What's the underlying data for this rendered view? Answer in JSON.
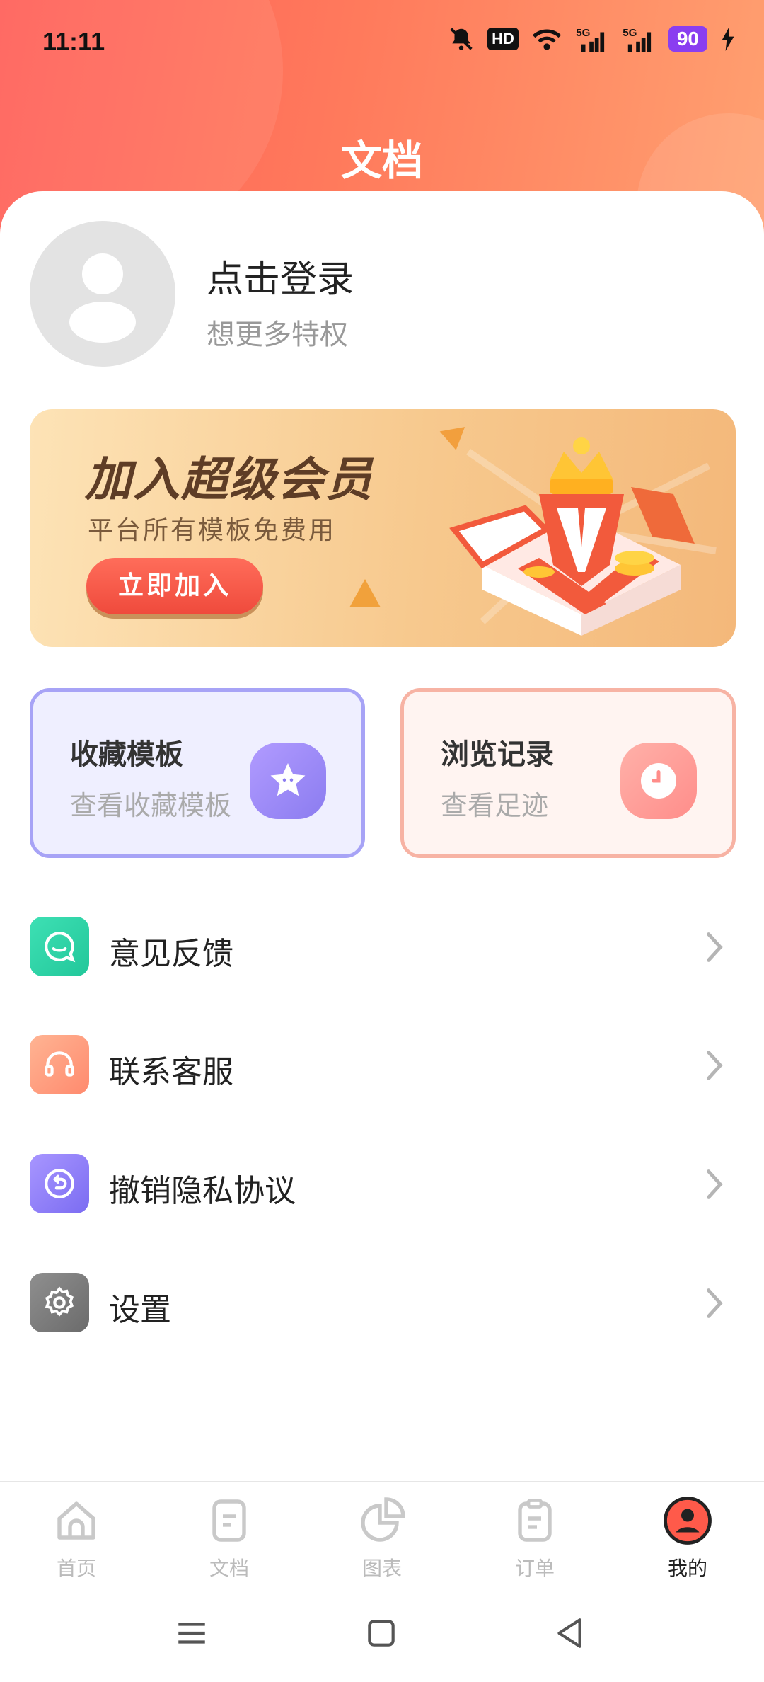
{
  "status_bar": {
    "time": "11:11",
    "battery": "90",
    "hd": "HD"
  },
  "header": {
    "title": "文档"
  },
  "profile": {
    "login_text": "点击登录",
    "login_sub": "想更多特权"
  },
  "vip_banner": {
    "title": "加入超级会员",
    "subtitle": "平台所有模板免费用",
    "button": "立即加入"
  },
  "cards": [
    {
      "title": "收藏模板",
      "subtitle": "查看收藏模板",
      "icon": "star-icon"
    },
    {
      "title": "浏览记录",
      "subtitle": "查看足迹",
      "icon": "clock-icon"
    }
  ],
  "menu": [
    {
      "label": "意见反馈",
      "icon": "feedback-icon",
      "color": "#2ed3a6"
    },
    {
      "label": "联系客服",
      "icon": "headset-icon",
      "color": "#ff9a7a"
    },
    {
      "label": "撤销隐私协议",
      "icon": "undo-icon",
      "color": "#8d7cf8"
    },
    {
      "label": "设置",
      "icon": "gear-icon",
      "color": "#7a7a7a"
    }
  ],
  "tabs": [
    {
      "label": "首页",
      "icon": "home-icon"
    },
    {
      "label": "文档",
      "icon": "document-icon"
    },
    {
      "label": "图表",
      "icon": "chart-icon"
    },
    {
      "label": "订单",
      "icon": "clipboard-icon"
    },
    {
      "label": "我的",
      "icon": "profile-icon",
      "active": true
    }
  ],
  "colors": {
    "header_start": "#ff5e57",
    "header_end": "#ffa070",
    "active_tab": "#ff5a4a"
  }
}
